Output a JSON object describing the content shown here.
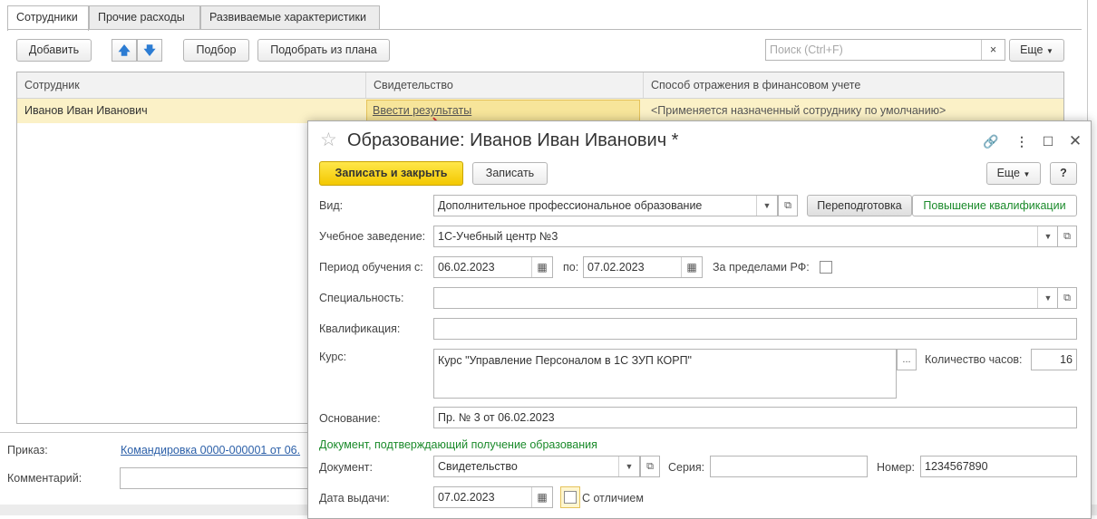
{
  "tabs": [
    "Сотрудники",
    "Прочие расходы",
    "Развиваемые характеристики"
  ],
  "toolbar": {
    "add": "Добавить",
    "up": "🡅",
    "down": "🡇",
    "select": "Подбор",
    "select_from_plan": "Подобрать из плана",
    "search_placeholder": "Поиск (Ctrl+F)",
    "search_clear": "×",
    "more": "Еще"
  },
  "table": {
    "columns": [
      "Сотрудник",
      "Свидетельство",
      "Способ отражения в финансовом учете"
    ],
    "rows": [
      {
        "employee": "Иванов Иван Иванович",
        "certificate": "Ввести результаты",
        "method": "<Применяется назначенный сотруднику по умолчанию>"
      }
    ]
  },
  "bottom": {
    "order_label": "Приказ:",
    "order_link": "Командировка 0000-000001 от 06.",
    "comment_label": "Комментарий:"
  },
  "dialog": {
    "title": "Образование: Иванов Иван Иванович *",
    "save_close": "Записать и закрыть",
    "save": "Записать",
    "more": "Еще",
    "help": "?",
    "kind_label": "Вид:",
    "kind_value": "Дополнительное профессиональное образование",
    "retraining": "Переподготовка",
    "qualification_up": "Повышение квалификации",
    "institution_label": "Учебное заведение:",
    "institution_value": "1С-Учебный центр №3",
    "period_label": "Период обучения с:",
    "period_from": "06.02.2023",
    "period_to_label": "по:",
    "period_to": "07.02.2023",
    "abroad_label": "За пределами РФ:",
    "specialty_label": "Специальность:",
    "specialty_value": "",
    "qualification_label": "Квалификация:",
    "qualification_value": "",
    "course_label": "Курс:",
    "course_value": "Курс \"Управление Персоналом в 1С ЗУП КОРП\"",
    "course_btn": "...",
    "hours_label": "Количество часов:",
    "hours_value": "16",
    "basis_label": "Основание:",
    "basis_value": "Пр. № 3 от 06.02.2023",
    "doc_section": "Документ, подтверждающий получение образования",
    "doc_label": "Документ:",
    "doc_value": "Свидетельство",
    "series_label": "Серия:",
    "series_value": "",
    "number_label": "Номер:",
    "number_value": "1234567890",
    "issue_label": "Дата выдачи:",
    "issue_value": "07.02.2023",
    "honors_label": "С отличием"
  },
  "colors": {
    "accent_yellow": "#f3c800",
    "row_highlight": "#fbf1c7",
    "green_text": "#1a8a2a",
    "annotation_arrow": "#e03030"
  }
}
